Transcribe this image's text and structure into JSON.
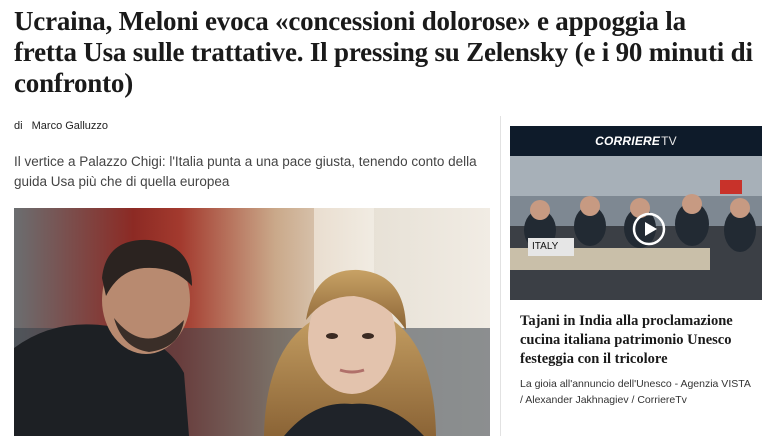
{
  "article": {
    "headline": "Ucraina, Meloni evoca «concessioni dolorose» e appoggia la fretta Usa sulle trattative. Il pressing su Zelensky (e i 90 minuti di confronto)",
    "byline_prefix": "di",
    "author": "Marco Galluzzo",
    "summary": "Il vertice a Palazzo Chigi: l'Italia punta a una pace giusta, tenendo conto della guida Usa più che di quella europea"
  },
  "sidebar_video": {
    "brand": "CORRIERE",
    "brand_suffix": "TV",
    "flag_label": "ITALY",
    "title": "Tajani in India alla proclamazione cucina italiana patrimonio Unesco festeggia con il tricolore",
    "caption": "La gioia all'annuncio dell'Unesco - Agenzia VISTA / Alexander Jakhnagiev / CorriereTv"
  },
  "icons": [
    "play-icon"
  ],
  "colors": {
    "tv_bar": "#0e1b2a",
    "headline": "#1a1a1a",
    "summary": "#444444"
  }
}
